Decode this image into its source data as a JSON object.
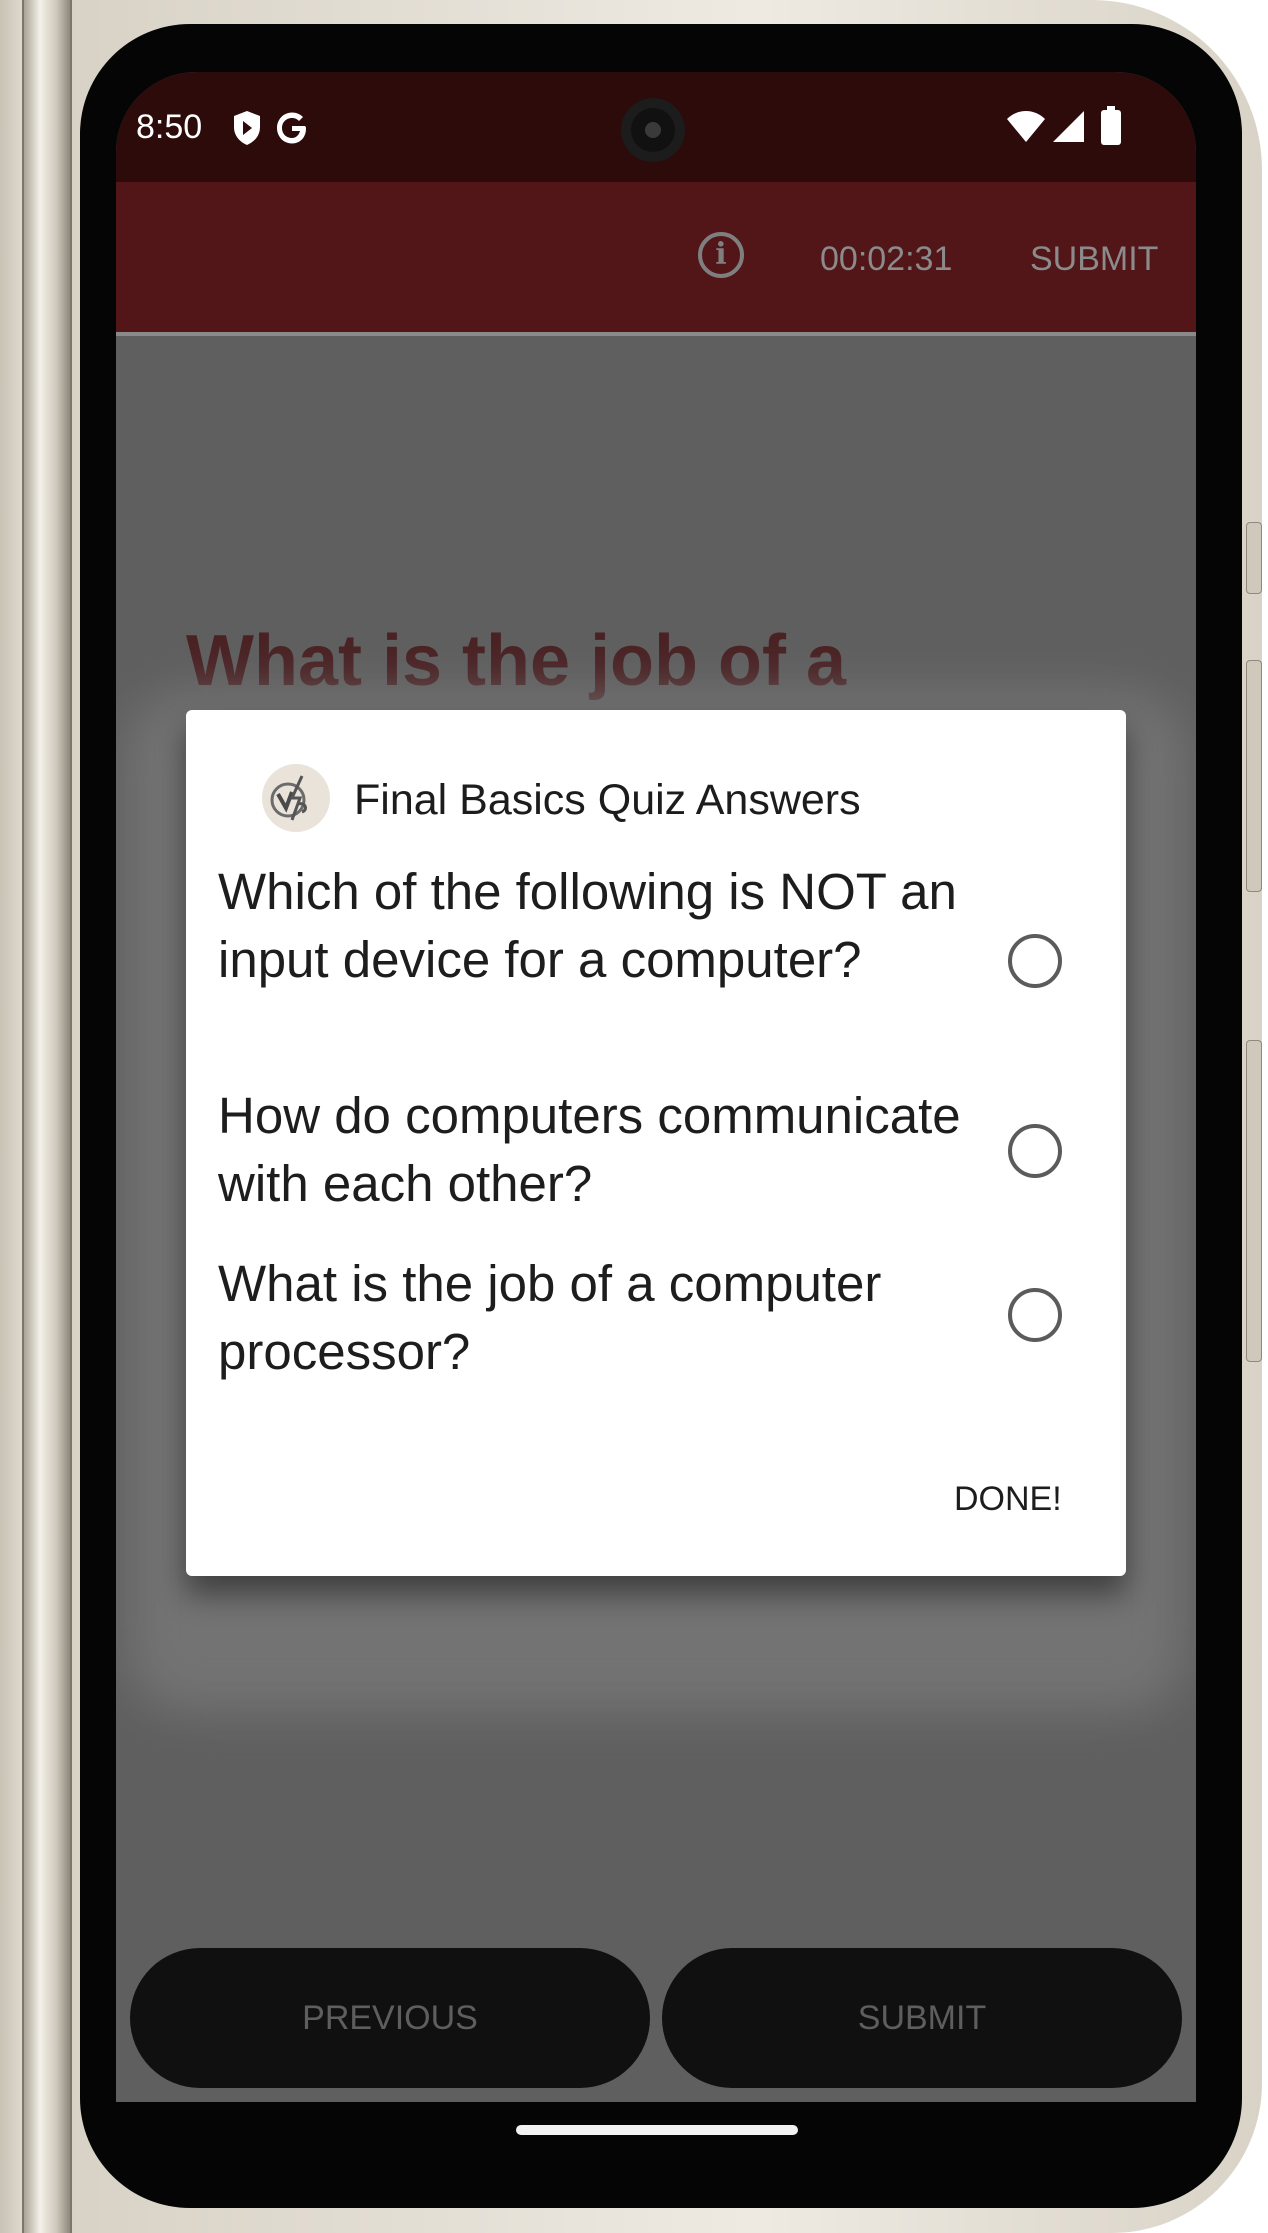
{
  "status_bar": {
    "time": "8:50"
  },
  "app_bar": {
    "timer": "00:02:31",
    "submit_label": "SUBMIT"
  },
  "background_question": {
    "title": "What is the job of a"
  },
  "dialog": {
    "title": "Final Basics Quiz Answers",
    "items": [
      {
        "label": "Which of the following is NOT an input device for a computer?",
        "selected": false
      },
      {
        "label": "How do computers communicate with each other?",
        "selected": false
      },
      {
        "label": "What is the job of a computer processor?",
        "selected": false
      }
    ],
    "done_label": "DONE!"
  },
  "bottom_bar": {
    "previous_label": "PREVIOUS",
    "submit_label": "SUBMIT"
  },
  "colors": {
    "status_bar": "#2d0b0b",
    "app_bar": "#521619",
    "scrim": "#5f5f5f",
    "dialog_bg": "#ffffff"
  },
  "icons": [
    "shield-icon",
    "google-icon",
    "wifi-icon",
    "signal-icon",
    "battery-icon",
    "info-icon",
    "app-logo-icon"
  ]
}
